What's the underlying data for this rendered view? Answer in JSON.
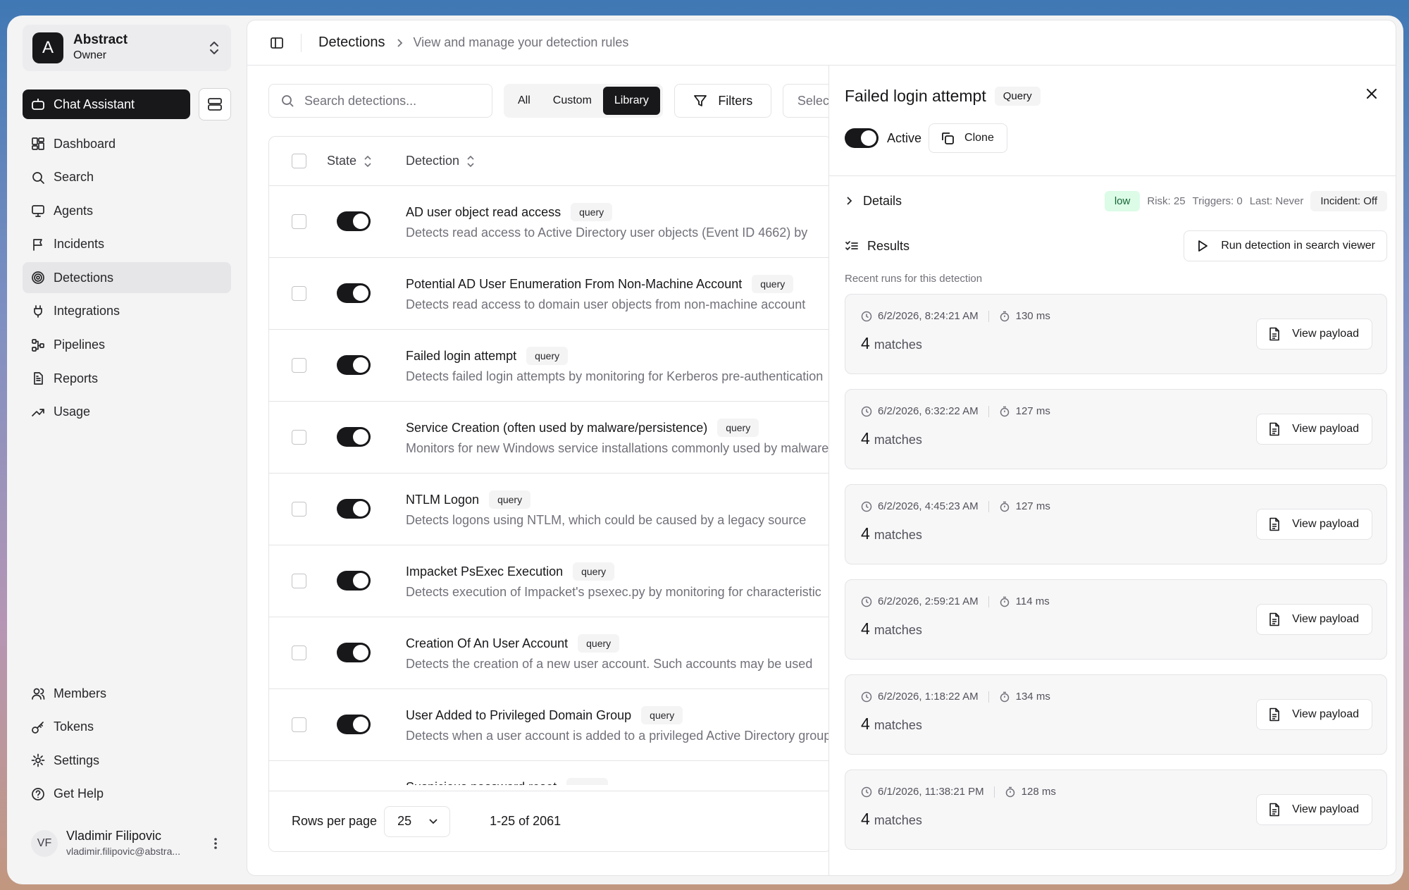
{
  "org": {
    "initial": "A",
    "name": "Abstract",
    "role": "Owner"
  },
  "chat_assistant_label": "Chat Assistant",
  "nav": [
    {
      "id": "dashboard",
      "label": "Dashboard",
      "icon": "dashboard-icon"
    },
    {
      "id": "search",
      "label": "Search",
      "icon": "search-icon"
    },
    {
      "id": "agents",
      "label": "Agents",
      "icon": "monitor-icon"
    },
    {
      "id": "incidents",
      "label": "Incidents",
      "icon": "flag-icon"
    },
    {
      "id": "detections",
      "label": "Detections",
      "icon": "target-icon",
      "active": true
    },
    {
      "id": "integrations",
      "label": "Integrations",
      "icon": "plug-icon"
    },
    {
      "id": "pipelines",
      "label": "Pipelines",
      "icon": "workflow-icon"
    },
    {
      "id": "reports",
      "label": "Reports",
      "icon": "report-icon"
    },
    {
      "id": "usage",
      "label": "Usage",
      "icon": "trend-icon"
    }
  ],
  "nav_bottom": [
    {
      "id": "members",
      "label": "Members",
      "icon": "users-icon"
    },
    {
      "id": "tokens",
      "label": "Tokens",
      "icon": "key-icon"
    },
    {
      "id": "settings",
      "label": "Settings",
      "icon": "gear-icon"
    },
    {
      "id": "get-help",
      "label": "Get Help",
      "icon": "help-icon"
    }
  ],
  "user": {
    "initials": "VF",
    "name": "Vladimir Filipovic",
    "email": "vladimir.filipovic@abstra..."
  },
  "breadcrumb": {
    "title": "Detections",
    "subtitle": "View and manage your detection rules"
  },
  "toolbar": {
    "search_placeholder": "Search detections...",
    "segments": [
      {
        "label": "All",
        "on": false
      },
      {
        "label": "Custom",
        "on": false
      },
      {
        "label": "Library",
        "on": true
      }
    ],
    "filters_label": "Filters",
    "select_label": "Select"
  },
  "table": {
    "headers": {
      "state": "State",
      "detection": "Detection"
    },
    "rows": [
      {
        "title": "AD user object read access",
        "tag": "query",
        "desc": "Detects read access to Active Directory user objects (Event ID 4662) by",
        "enabled": true
      },
      {
        "title": "Potential AD User Enumeration From Non-Machine Account",
        "tag": "query",
        "desc": "Detects read access to domain user objects from non-machine account",
        "enabled": true
      },
      {
        "title": "Failed login attempt",
        "tag": "query",
        "desc": "Detects failed login attempts by monitoring for Kerberos pre-authentication",
        "enabled": true
      },
      {
        "title": "Service Creation (often used by malware/persistence)",
        "tag": "query",
        "desc": "Monitors for new Windows service installations commonly used by malware",
        "enabled": true
      },
      {
        "title": "NTLM Logon",
        "tag": "query",
        "desc": "Detects logons using NTLM, which could be caused by a legacy source",
        "enabled": true
      },
      {
        "title": "Impacket PsExec Execution",
        "tag": "query",
        "desc": "Detects execution of Impacket's psexec.py by monitoring for characteristic",
        "enabled": true
      },
      {
        "title": "Creation Of An User Account",
        "tag": "query",
        "desc": "Detects the creation of a new user account. Such accounts may be used",
        "enabled": true
      },
      {
        "title": "User Added to Privileged Domain Group",
        "tag": "query",
        "desc": "Detects when a user account is added to a privileged Active Directory group",
        "enabled": true
      },
      {
        "title": "Suspicious password reset",
        "tag": "query",
        "desc": "",
        "enabled": true
      }
    ],
    "footer": {
      "rows_per_page_label": "Rows per page",
      "rows_per_page_value": "25",
      "range": "1-25 of 2061"
    }
  },
  "detail": {
    "title": "Failed login attempt",
    "badge": "Query",
    "active_label": "Active",
    "active": true,
    "clone_label": "Clone",
    "details_label": "Details",
    "severity": "low",
    "risk": "Risk: 25",
    "triggers": "Triggers: 0",
    "last": "Last: Never",
    "incident": "Incident: Off",
    "results_label": "Results",
    "run_button_label": "Run detection in search viewer",
    "recent_label": "Recent runs for this detection",
    "runs": [
      {
        "timestamp": "6/2/2026, 8:24:21 AM",
        "duration": "130 ms",
        "count": "4",
        "matches_label": "matches",
        "button": "View payload"
      },
      {
        "timestamp": "6/2/2026, 6:32:22 AM",
        "duration": "127 ms",
        "count": "4",
        "matches_label": "matches",
        "button": "View payload"
      },
      {
        "timestamp": "6/2/2026, 4:45:23 AM",
        "duration": "127 ms",
        "count": "4",
        "matches_label": "matches",
        "button": "View payload"
      },
      {
        "timestamp": "6/2/2026, 2:59:21 AM",
        "duration": "114 ms",
        "count": "4",
        "matches_label": "matches",
        "button": "View payload"
      },
      {
        "timestamp": "6/2/2026, 1:18:22 AM",
        "duration": "134 ms",
        "count": "4",
        "matches_label": "matches",
        "button": "View payload"
      },
      {
        "timestamp": "6/1/2026, 11:38:21 PM",
        "duration": "128 ms",
        "count": "4",
        "matches_label": "matches",
        "button": "View payload"
      }
    ]
  }
}
